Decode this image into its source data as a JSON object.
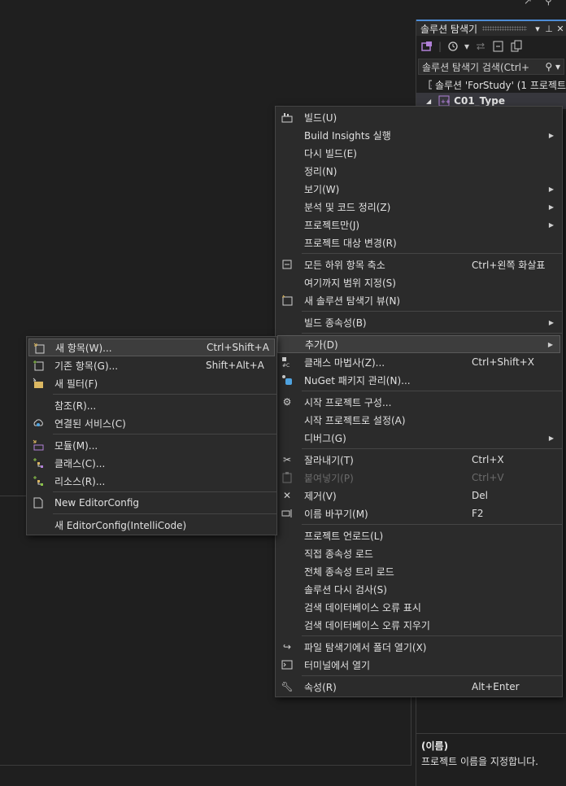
{
  "top_icons": [
    "↗",
    "⚲"
  ],
  "solution_explorer": {
    "title": "솔루션 탐색기",
    "title_controls": [
      "▾",
      "⊥",
      "✕"
    ],
    "search_placeholder": "솔루션 탐색기 검색(Ctrl+",
    "search_icon": "🔍",
    "tree": [
      {
        "label": "솔루션 'ForStudy' (1 프로젝트",
        "type": "solution"
      },
      {
        "label": "C01_Type",
        "type": "project"
      }
    ],
    "properties": {
      "name_label": "(이름)",
      "description": "프로젝트 이름을 지정합니다."
    }
  },
  "main_menu": {
    "items": [
      {
        "label": "빌드(U)",
        "shortcut": "",
        "icon": "build-icon",
        "arrow": false
      },
      {
        "label": "Build Insights 실행",
        "shortcut": "",
        "icon": "",
        "arrow": true
      },
      {
        "label": "다시 빌드(E)",
        "shortcut": "",
        "icon": "",
        "arrow": false
      },
      {
        "label": "정리(N)",
        "shortcut": "",
        "icon": "",
        "arrow": false
      },
      {
        "label": "보기(W)",
        "shortcut": "",
        "icon": "",
        "arrow": true
      },
      {
        "label": "분석 및 코드 정리(Z)",
        "shortcut": "",
        "icon": "",
        "arrow": true
      },
      {
        "label": "프로젝트만(J)",
        "shortcut": "",
        "icon": "",
        "arrow": true
      },
      {
        "label": "프로젝트 대상 변경(R)",
        "shortcut": "",
        "icon": "",
        "arrow": false
      },
      {
        "label": "모든 하위 항목 축소",
        "shortcut": "Ctrl+왼쪽 화살표",
        "icon": "collapse-icon",
        "arrow": false
      },
      {
        "label": "여기까지 범위 지정(S)",
        "shortcut": "",
        "icon": "",
        "arrow": false
      },
      {
        "label": "새 솔루션 탐색기 뷰(N)",
        "shortcut": "",
        "icon": "new-view-icon",
        "arrow": false
      },
      {
        "label": "빌드 종속성(B)",
        "shortcut": "",
        "icon": "",
        "arrow": true
      },
      {
        "label": "추가(D)",
        "shortcut": "",
        "icon": "",
        "arrow": true
      },
      {
        "label": "클래스 마법사(Z)...",
        "shortcut": "Ctrl+Shift+X",
        "icon": "class-wizard-icon",
        "arrow": false
      },
      {
        "label": "NuGet 패키지 관리(N)...",
        "shortcut": "",
        "icon": "nuget-icon",
        "arrow": false
      },
      {
        "label": "시작 프로젝트 구성...",
        "shortcut": "",
        "icon": "gear-icon",
        "arrow": false
      },
      {
        "label": "시작 프로젝트로 설정(A)",
        "shortcut": "",
        "icon": "",
        "arrow": false
      },
      {
        "label": "디버그(G)",
        "shortcut": "",
        "icon": "",
        "arrow": true
      },
      {
        "label": "잘라내기(T)",
        "shortcut": "Ctrl+X",
        "icon": "scissors-icon",
        "arrow": false
      },
      {
        "label": "붙여넣기(P)",
        "shortcut": "Ctrl+V",
        "icon": "paste-icon",
        "arrow": false,
        "disabled": true
      },
      {
        "label": "제거(V)",
        "shortcut": "Del",
        "icon": "remove-icon",
        "arrow": false
      },
      {
        "label": "이름 바꾸기(M)",
        "shortcut": "F2",
        "icon": "rename-icon",
        "arrow": false
      },
      {
        "label": "프로젝트 언로드(L)",
        "shortcut": "",
        "icon": "",
        "arrow": false
      },
      {
        "label": "직접 종속성 로드",
        "shortcut": "",
        "icon": "",
        "arrow": false
      },
      {
        "label": "전체 종속성 트리 로드",
        "shortcut": "",
        "icon": "",
        "arrow": false
      },
      {
        "label": "솔루션 다시 검사(S)",
        "shortcut": "",
        "icon": "",
        "arrow": false
      },
      {
        "label": "검색 데이터베이스 오류 표시",
        "shortcut": "",
        "icon": "",
        "arrow": false
      },
      {
        "label": "검색 데이터베이스 오류 지우기",
        "shortcut": "",
        "icon": "",
        "arrow": false
      },
      {
        "label": "파일 탐색기에서 폴더 열기(X)",
        "shortcut": "",
        "icon": "open-folder-icon",
        "arrow": false
      },
      {
        "label": "터미널에서 열기",
        "shortcut": "",
        "icon": "terminal-icon",
        "arrow": false
      },
      {
        "label": "속성(R)",
        "shortcut": "Alt+Enter",
        "icon": "wrench-icon",
        "arrow": false
      }
    ]
  },
  "sub_menu": {
    "items": [
      {
        "label": "새 항목(W)...",
        "shortcut": "Ctrl+Shift+A",
        "icon": "new-item-icon"
      },
      {
        "label": "기존 항목(G)...",
        "shortcut": "Shift+Alt+A",
        "icon": "existing-item-icon"
      },
      {
        "label": "새 필터(F)",
        "shortcut": "",
        "icon": "new-filter-icon"
      },
      {
        "label": "참조(R)...",
        "shortcut": "",
        "icon": ""
      },
      {
        "label": "연결된 서비스(C)",
        "shortcut": "",
        "icon": "connected-service-icon"
      },
      {
        "label": "모듈(M)...",
        "shortcut": "",
        "icon": "module-icon"
      },
      {
        "label": "클래스(C)...",
        "shortcut": "",
        "icon": "class-icon"
      },
      {
        "label": "리소스(R)...",
        "shortcut": "",
        "icon": "resource-icon"
      },
      {
        "label": "New EditorConfig",
        "shortcut": "",
        "icon": "file-icon"
      },
      {
        "label": "새 EditorConfig(IntelliCode)",
        "shortcut": "",
        "icon": ""
      }
    ]
  }
}
